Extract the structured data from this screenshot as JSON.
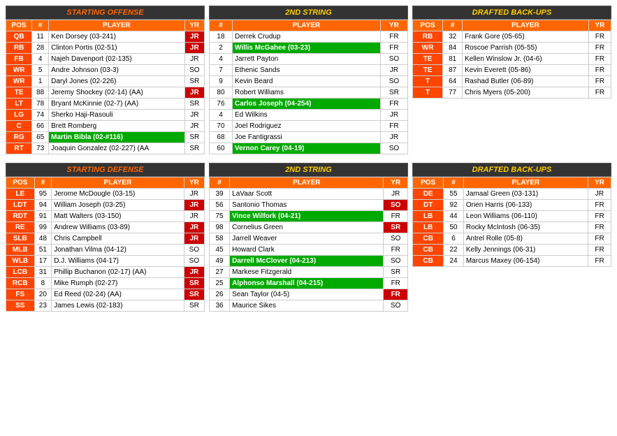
{
  "offense": {
    "starting": {
      "title": "STARTING OFFENSE",
      "headers": [
        "POS",
        "#",
        "PLAYER",
        "YR"
      ],
      "rows": [
        {
          "pos": "QB",
          "num": "11",
          "player": "Ken Dorsey (03-241)",
          "yr": "JR",
          "green": false,
          "yr_red": true
        },
        {
          "pos": "RB",
          "num": "28",
          "player": "Clinton Portis (02-51)",
          "yr": "JR",
          "green": false,
          "yr_red": true
        },
        {
          "pos": "FB",
          "num": "4",
          "player": "Najeh Davenport (02-135)",
          "yr": "JR",
          "green": false,
          "yr_red": false
        },
        {
          "pos": "WR",
          "num": "5",
          "player": "Andre Johnson (03-3)",
          "yr": "SO",
          "green": false,
          "yr_red": false
        },
        {
          "pos": "WR",
          "num": "1",
          "player": "Daryl Jones (02-226)",
          "yr": "SR",
          "green": false,
          "yr_red": false
        },
        {
          "pos": "TE",
          "num": "88",
          "player": "Jeremy Shockey (02-14) (AA)",
          "yr": "JR",
          "green": false,
          "yr_red": true
        },
        {
          "pos": "LT",
          "num": "78",
          "player": "Bryant McKinnie (02-7) (AA)",
          "yr": "SR",
          "green": false,
          "yr_red": false
        },
        {
          "pos": "LG",
          "num": "74",
          "player": "Sherko Haji-Rasouli",
          "yr": "JR",
          "green": false,
          "yr_red": false
        },
        {
          "pos": "C",
          "num": "66",
          "player": "Brett Romberg",
          "yr": "JR",
          "green": false,
          "yr_red": false
        },
        {
          "pos": "RG",
          "num": "65",
          "player": "Martin Bibla (02-#116)",
          "yr": "SR",
          "green": true,
          "yr_red": false
        },
        {
          "pos": "RT",
          "num": "73",
          "player": "Joaquin Gonzalez (02-227) (AA",
          "yr": "SR",
          "green": false,
          "yr_red": false
        }
      ]
    },
    "second": {
      "title": "2ND STRING",
      "headers": [
        "#",
        "PLAYER",
        "YR"
      ],
      "rows": [
        {
          "num": "18",
          "player": "Derrek Crudup",
          "yr": "FR",
          "green": false,
          "yr_red": false
        },
        {
          "num": "2",
          "player": "Willis McGahee (03-23)",
          "yr": "FR",
          "green": true,
          "yr_red": false
        },
        {
          "num": "4",
          "player": "Jarrett Payton",
          "yr": "SO",
          "green": false,
          "yr_red": false
        },
        {
          "num": "7",
          "player": "Ethenic Sands",
          "yr": "JR",
          "green": false,
          "yr_red": false
        },
        {
          "num": "9",
          "player": "Kevin Beard",
          "yr": "SO",
          "green": false,
          "yr_red": false
        },
        {
          "num": "80",
          "player": "Robert Williams",
          "yr": "SR",
          "green": false,
          "yr_red": false
        },
        {
          "num": "76",
          "player": "Carlos Joseph (04-254)",
          "yr": "FR",
          "green": true,
          "yr_red": false
        },
        {
          "num": "4",
          "player": "Ed Wilkins",
          "yr": "JR",
          "green": false,
          "yr_red": false
        },
        {
          "num": "70",
          "player": "Joel Rodriguez",
          "yr": "FR",
          "green": false,
          "yr_red": false
        },
        {
          "num": "68",
          "player": "Joe Fantigrassi",
          "yr": "JR",
          "green": false,
          "yr_red": false
        },
        {
          "num": "60",
          "player": "Vernon Carey (04-19)",
          "yr": "SO",
          "green": true,
          "yr_red": false
        }
      ]
    },
    "drafted": {
      "title": "DRAFTED BACK-UPS",
      "headers": [
        "POS",
        "#",
        "PLAYER",
        "YR"
      ],
      "rows": [
        {
          "pos": "RB",
          "num": "32",
          "player": "Frank Gore (05-65)",
          "yr": "FR",
          "green": false
        },
        {
          "pos": "WR",
          "num": "84",
          "player": "Roscoe Parrish (05-55)",
          "yr": "FR",
          "green": false
        },
        {
          "pos": "TE",
          "num": "81",
          "player": "Kellen Winslow Jr. (04-6)",
          "yr": "FR",
          "green": false
        },
        {
          "pos": "TE",
          "num": "87",
          "player": "Kevin Everett (05-86)",
          "yr": "FR",
          "green": false
        },
        {
          "pos": "T",
          "num": "64",
          "player": "Rashad Butler (06-89)",
          "yr": "FR",
          "green": false
        },
        {
          "pos": "T",
          "num": "77",
          "player": "Chris Myers (05-200)",
          "yr": "FR",
          "green": false
        }
      ]
    }
  },
  "defense": {
    "starting": {
      "title": "STARTING DEFENSE",
      "headers": [
        "POS",
        "#",
        "PLAYER",
        "YR"
      ],
      "rows": [
        {
          "pos": "LE",
          "num": "95",
          "player": "Jerome McDougle (03-15)",
          "yr": "JR",
          "green": false,
          "yr_red": false
        },
        {
          "pos": "LDT",
          "num": "94",
          "player": "William Joseph (03-25)",
          "yr": "JR",
          "green": false,
          "yr_red": true
        },
        {
          "pos": "RDT",
          "num": "91",
          "player": "Matt Walters (03-150)",
          "yr": "JR",
          "green": false,
          "yr_red": false
        },
        {
          "pos": "RE",
          "num": "99",
          "player": "Andrew Williams (03-89)",
          "yr": "JR",
          "green": false,
          "yr_red": true
        },
        {
          "pos": "SLB",
          "num": "48",
          "player": "Chris Campbell",
          "yr": "JR",
          "green": false,
          "yr_red": true
        },
        {
          "pos": "MLB",
          "num": "51",
          "player": "Jonathan Vilma (04-12)",
          "yr": "SO",
          "green": false,
          "yr_red": false
        },
        {
          "pos": "WLB",
          "num": "17",
          "player": "D.J. Williams (04-17)",
          "yr": "SO",
          "green": false,
          "yr_red": false
        },
        {
          "pos": "LCB",
          "num": "31",
          "player": "Phillip Buchanon (02-17) (AA)",
          "yr": "JR",
          "green": false,
          "yr_red": true
        },
        {
          "pos": "RCB",
          "num": "8",
          "player": "Mike Rumph (02-27)",
          "yr": "SR",
          "green": false,
          "yr_red": true
        },
        {
          "pos": "FS",
          "num": "20",
          "player": "Ed Reed (02-24) (AA)",
          "yr": "SR",
          "green": false,
          "yr_red": true
        },
        {
          "pos": "SS",
          "num": "23",
          "player": "James Lewis (02-183)",
          "yr": "SR",
          "green": false,
          "yr_red": false
        }
      ]
    },
    "second": {
      "title": "2ND STRING",
      "headers": [
        "#",
        "PLAYER",
        "YR"
      ],
      "rows": [
        {
          "num": "39",
          "player": "LaVaar Scott",
          "yr": "JR",
          "green": false,
          "yr_red": false
        },
        {
          "num": "56",
          "player": "Santonio Thomas",
          "yr": "SO",
          "green": false,
          "yr_red": true
        },
        {
          "num": "75",
          "player": "Vince Wilfork (04-21)",
          "yr": "FR",
          "green": true,
          "yr_red": false
        },
        {
          "num": "98",
          "player": "Cornelius Green",
          "yr": "SR",
          "green": false,
          "yr_red": true
        },
        {
          "num": "58",
          "player": "Jarrell Weaver",
          "yr": "SO",
          "green": false,
          "yr_red": false
        },
        {
          "num": "45",
          "player": "Howard Clark",
          "yr": "FR",
          "green": false,
          "yr_red": false
        },
        {
          "num": "49",
          "player": "Darrell McClover (04-213)",
          "yr": "SO",
          "green": true,
          "yr_red": false
        },
        {
          "num": "27",
          "player": "Markese Fitzgerald",
          "yr": "SR",
          "green": false,
          "yr_red": false
        },
        {
          "num": "25",
          "player": "Alphonso Marshall (04-215)",
          "yr": "FR",
          "green": true,
          "yr_red": false
        },
        {
          "num": "26",
          "player": "Sean Taylor (04-5)",
          "yr": "FR",
          "green": false,
          "yr_red": true
        },
        {
          "num": "36",
          "player": "Maurice Sikes",
          "yr": "SO",
          "green": false,
          "yr_red": false
        }
      ]
    },
    "drafted": {
      "title": "DRAFTED BACK-UPS",
      "headers": [
        "POS",
        "#",
        "PLAYER",
        "YR"
      ],
      "rows": [
        {
          "pos": "DE",
          "num": "55",
          "player": "Jamaal Green (03-131)",
          "yr": "JR",
          "green": false
        },
        {
          "pos": "DT",
          "num": "92",
          "player": "Orien Harris (06-133)",
          "yr": "FR",
          "green": false
        },
        {
          "pos": "LB",
          "num": "44",
          "player": "Leon Williams (06-110)",
          "yr": "FR",
          "green": false
        },
        {
          "pos": "LB",
          "num": "50",
          "player": "Rocky McIntosh (06-35)",
          "yr": "FR",
          "green": false
        },
        {
          "pos": "CB",
          "num": "6",
          "player": "Antrel Rolle (05-8)",
          "yr": "FR",
          "green": false
        },
        {
          "pos": "CB",
          "num": "22",
          "player": "Kelly Jennings (06-31)",
          "yr": "FR",
          "green": false
        },
        {
          "pos": "CB",
          "num": "24",
          "player": "Marcus Maxey (06-154)",
          "yr": "FR",
          "green": false
        }
      ]
    }
  }
}
